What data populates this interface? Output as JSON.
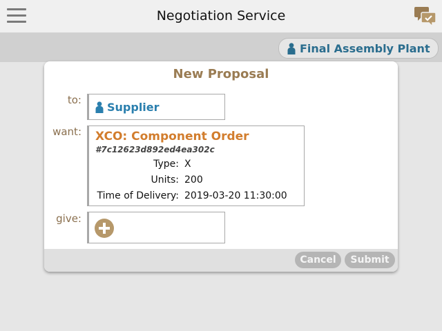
{
  "app": {
    "title": "Negotiation Service"
  },
  "header": {
    "menu_icon": "hamburger-menu-icon",
    "chat_icon": "chat-bubbles-icon"
  },
  "context_tab": {
    "label": "Final Assembly Plant",
    "icon": "person-icon"
  },
  "dialog": {
    "title": "New Proposal",
    "to_label": "to:",
    "want_label": "want:",
    "give_label": "give:",
    "recipient": {
      "name": "Supplier",
      "icon": "person-icon"
    },
    "want_item": {
      "title": "XCO: Component Order",
      "id": "#7c12623d892ed4ea302c",
      "fields": [
        {
          "key": "Type:",
          "value": "X"
        },
        {
          "key": "Units:",
          "value": "200"
        },
        {
          "key": "Time of Delivery:",
          "value": "2019-03-20 11:30:00"
        }
      ]
    },
    "give_add_icon": "plus-circle-icon",
    "cancel_label": "Cancel",
    "submit_label": "Submit"
  },
  "colors": {
    "accent_brown": "#9a7c53",
    "link_blue": "#2a7fae",
    "order_orange": "#d27d2d",
    "button_gray": "#b5b5b5"
  }
}
